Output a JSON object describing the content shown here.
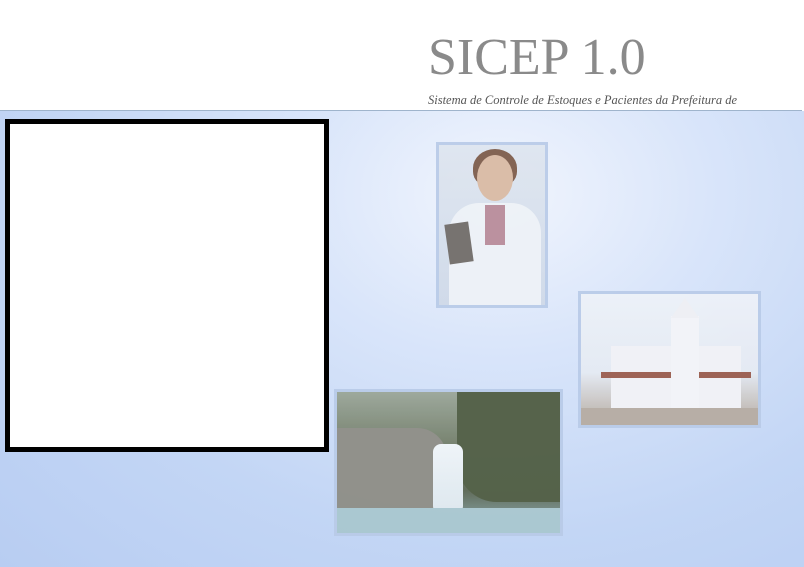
{
  "header": {
    "title": "SICEP 1.0",
    "subtitle": "Sistema de Controle de Estoques e Pacientes da Prefeitura de"
  },
  "colors": {
    "title": "#8a8a8a",
    "background": "#c3d6f5",
    "panel_border": "#000000"
  },
  "images": [
    "doctor-photo",
    "church-photo",
    "waterfall-photo"
  ]
}
